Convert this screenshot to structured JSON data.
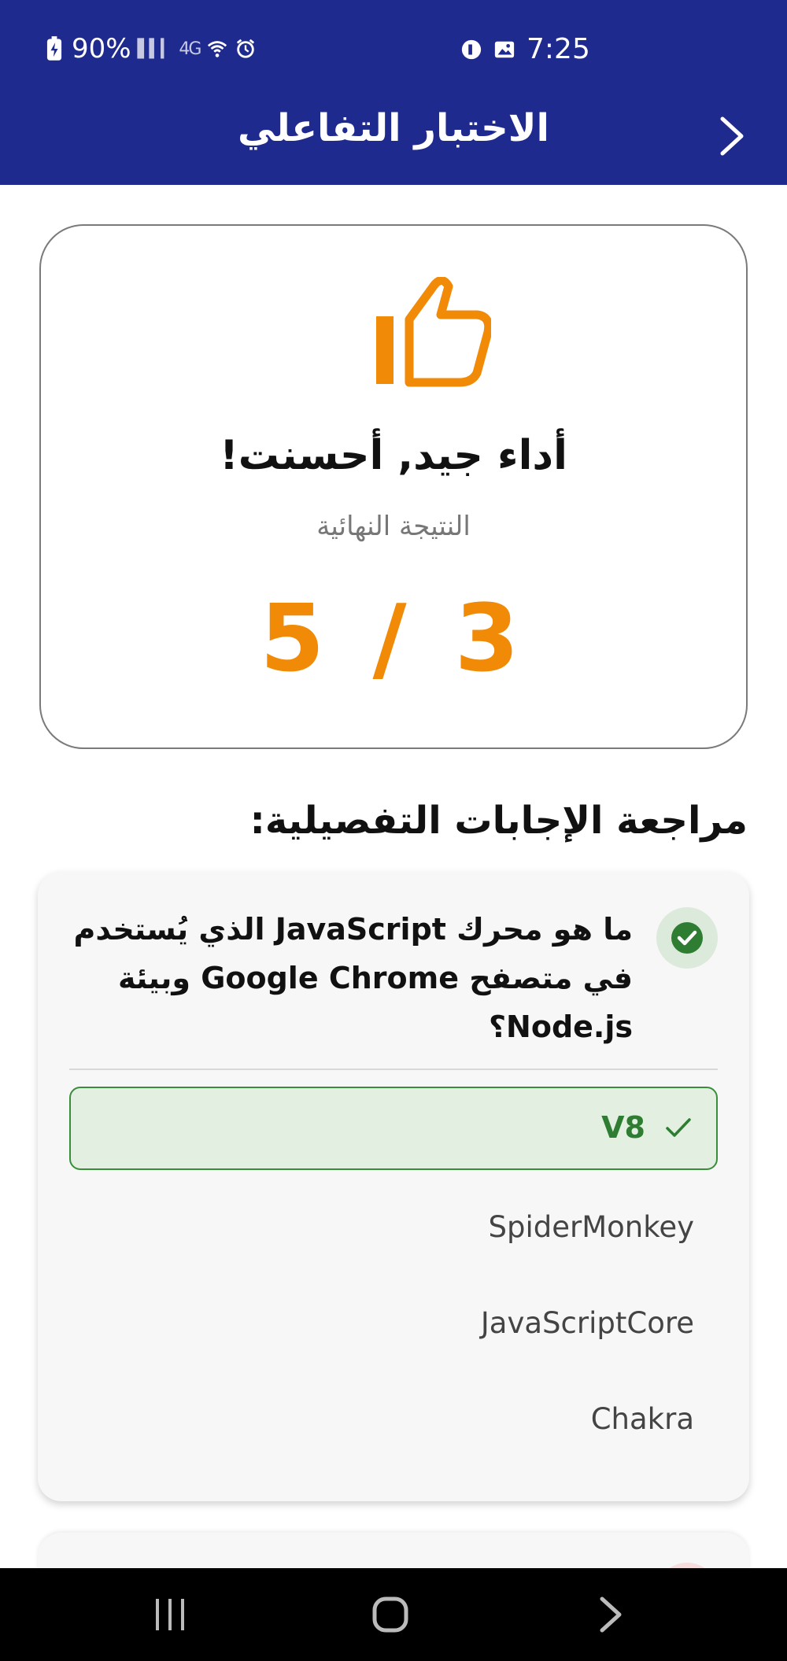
{
  "status_bar": {
    "battery": "90%",
    "time": "7:25",
    "network_label": "4G"
  },
  "app_bar": {
    "title": "الاختبار التفاعلي"
  },
  "result": {
    "message": "أداء جيد, أحسنت!",
    "subtitle": "النتيجة النهائية",
    "score": "5 / 3",
    "accent_color": "#f08a07"
  },
  "review": {
    "title": "مراجعة الإجابات التفصيلية:",
    "questions": [
      {
        "text": "ما هو محرك JavaScript الذي يُستخدم في متصفح Google Chrome وبيئة Node.js؟",
        "status": "correct",
        "options": [
          {
            "label": "V8",
            "state": "correct-selected"
          },
          {
            "label": "SpiderMonkey",
            "state": "unselected"
          },
          {
            "label": "JavaScriptCore",
            "state": "unselected"
          },
          {
            "label": "Chakra",
            "state": "unselected"
          }
        ]
      }
    ]
  },
  "icons": {
    "back": "chevron-right-icon",
    "result": "thumbs-up-icon",
    "correct": "check-circle-icon"
  },
  "colors": {
    "primary": "#1f2a8f",
    "correct_green": "#2e7d32",
    "correct_bg": "#e3f0e1"
  }
}
